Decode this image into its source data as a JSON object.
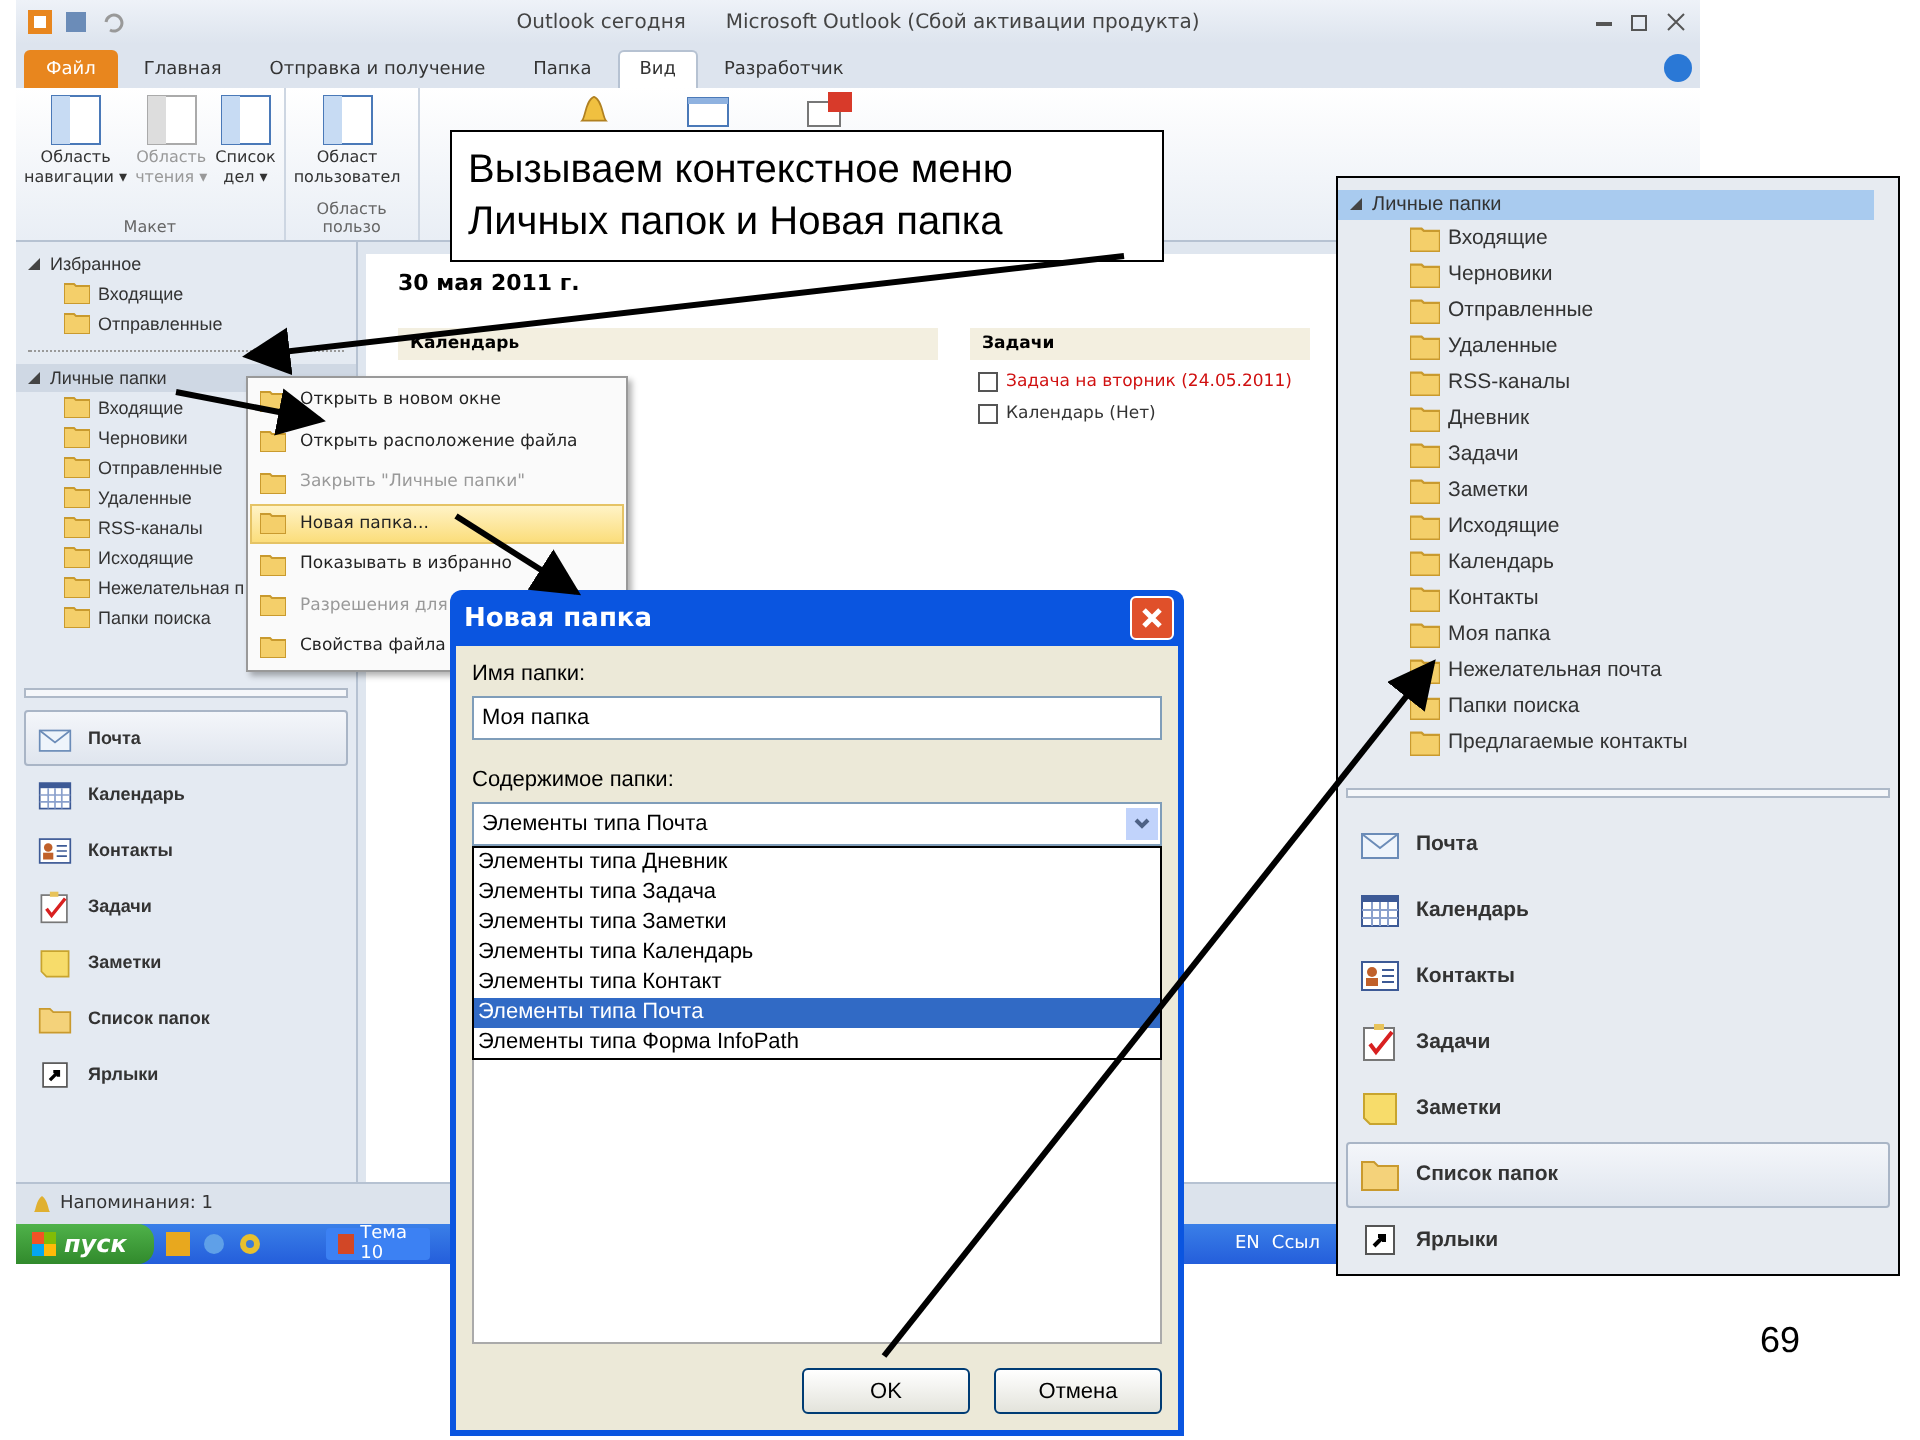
{
  "outlook": {
    "title": "Outlook сегодня",
    "app_title": "Microsoft Outlook (Сбой активации продукта)",
    "tabs": [
      {
        "label": "Файл",
        "kind": "file",
        "selected": false
      },
      {
        "label": "Главная",
        "kind": "tab",
        "selected": false
      },
      {
        "label": "Отправка и получение",
        "kind": "tab",
        "selected": false
      },
      {
        "label": "Папка",
        "kind": "tab",
        "selected": false
      },
      {
        "label": "Вид",
        "kind": "tab",
        "selected": true
      },
      {
        "label": "Разработчик",
        "kind": "tab",
        "selected": false
      }
    ],
    "ribbon": [
      {
        "label": "Макет",
        "buttons": [
          {
            "lines": [
              "Область",
              "навигации ▾"
            ],
            "disabled": false
          },
          {
            "lines": [
              "Область",
              "чтения ▾"
            ],
            "disabled": true
          },
          {
            "lines": [
              "Список",
              "дел ▾"
            ],
            "disabled": false
          }
        ]
      },
      {
        "label": "Область пользо",
        "buttons": [
          {
            "lines": [
              "Област",
              "пользовател"
            ],
            "disabled": false
          }
        ]
      }
    ],
    "folders": [
      {
        "label": "Избранное",
        "expanded": true,
        "selected": false,
        "children": [
          {
            "label": "Входящие"
          },
          {
            "label": "Отправленные"
          }
        ]
      },
      {
        "label": "Личные папки",
        "expanded": true,
        "selected": true,
        "children": [
          {
            "label": "Входящие"
          },
          {
            "label": "Черновики"
          },
          {
            "label": "Отправленные"
          },
          {
            "label": "Удаленные"
          },
          {
            "label": "RSS-каналы"
          },
          {
            "label": "Исходящие"
          },
          {
            "label": "Нежелательная п"
          },
          {
            "label": "Папки поиска"
          }
        ]
      }
    ],
    "nav": [
      {
        "label": "Почта",
        "selected": true
      },
      {
        "label": "Календарь",
        "selected": false
      },
      {
        "label": "Контакты",
        "selected": false
      },
      {
        "label": "Задачи",
        "selected": false
      },
      {
        "label": "Заметки",
        "selected": false
      },
      {
        "label": "Список папок",
        "selected": false
      },
      {
        "label": "Ярлыки",
        "selected": false
      }
    ],
    "content": {
      "date": "30 мая 2011 г.",
      "calendar_header": "Календарь",
      "tasks_header": "Задачи",
      "tasks": [
        {
          "label": "Задача на вторник (24.05.2011)",
          "checked": false,
          "overdue": true
        },
        {
          "label": "Календарь (Нет)",
          "checked": false,
          "overdue": false
        }
      ]
    },
    "status": "Напоминания: 1",
    "taskbar": {
      "start": "пуск",
      "task": "Тема 10",
      "language": "EN",
      "tray": "Ссыл"
    }
  },
  "callout": "Вызываем контекстное меню Личных папок и Новая папка",
  "context_menu": [
    {
      "label": "Открыть в новом окне",
      "disabled": false,
      "selected": false
    },
    {
      "label": "Открыть расположение файла",
      "disabled": false,
      "selected": false
    },
    {
      "label": "Закрыть \"Личные папки\"",
      "disabled": true,
      "selected": false
    },
    {
      "label": "Новая папка...",
      "disabled": false,
      "selected": true
    },
    {
      "label": "Показывать в избранно",
      "disabled": false,
      "selected": false
    },
    {
      "label": "Разрешения для",
      "disabled": true,
      "selected": false
    },
    {
      "label": "Свойства файла",
      "disabled": false,
      "selected": false
    }
  ],
  "dialog": {
    "title": "Новая папка",
    "name_label": "Имя папки:",
    "name_value": "Моя папка",
    "content_label": "Содержимое папки:",
    "content_value": "Элементы типа Почта",
    "options": [
      {
        "label": "Элементы типа Дневник",
        "selected": false
      },
      {
        "label": "Элементы типа Задача",
        "selected": false
      },
      {
        "label": "Элементы типа Заметки",
        "selected": false
      },
      {
        "label": "Элементы типа Календарь",
        "selected": false
      },
      {
        "label": "Элементы типа Контакт",
        "selected": false
      },
      {
        "label": "Элементы типа Почта",
        "selected": true
      },
      {
        "label": "Элементы типа Форма InfoPath",
        "selected": false
      }
    ],
    "buttons": [
      "OK",
      "Отмена"
    ]
  },
  "right_panel": {
    "folders": {
      "label": "Личные папки",
      "expanded": true,
      "selected": true,
      "children": [
        {
          "label": "Входящие"
        },
        {
          "label": "Черновики"
        },
        {
          "label": "Отправленные"
        },
        {
          "label": "Удаленные"
        },
        {
          "label": "RSS-каналы"
        },
        {
          "label": "Дневник"
        },
        {
          "label": "Задачи"
        },
        {
          "label": "Заметки"
        },
        {
          "label": "Исходящие"
        },
        {
          "label": "Календарь"
        },
        {
          "label": "Контакты"
        },
        {
          "label": "Моя папка"
        },
        {
          "label": "Нежелательная почта"
        },
        {
          "label": "Папки поиска"
        },
        {
          "label": "Предлагаемые контакты"
        }
      ]
    },
    "nav": [
      {
        "label": "Почта",
        "selected": false
      },
      {
        "label": "Календарь",
        "selected": false
      },
      {
        "label": "Контакты",
        "selected": false
      },
      {
        "label": "Задачи",
        "selected": false
      },
      {
        "label": "Заметки",
        "selected": false
      },
      {
        "label": "Список папок",
        "selected": true
      },
      {
        "label": "Ярлыки",
        "selected": false
      }
    ]
  },
  "page_number": "69"
}
